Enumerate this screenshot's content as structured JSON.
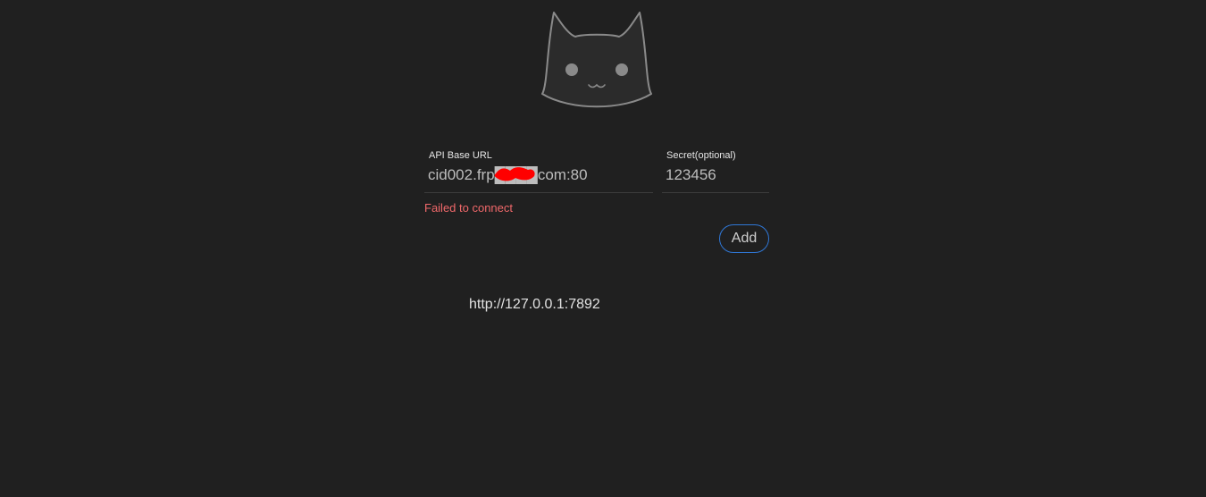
{
  "logo": {
    "icon": "cat-face-icon"
  },
  "form": {
    "api_base_url": {
      "label": "API Base URL",
      "value": "cid002.frp████com:80"
    },
    "secret": {
      "label": "Secret(optional)",
      "value": "123456"
    },
    "error": "Failed to connect",
    "add_label": "Add"
  },
  "backends": [
    {
      "url": "http://127.0.0.1:7892"
    }
  ],
  "colors": {
    "background": "#202020",
    "error": "#f0686a",
    "button_border": "#2f77d6",
    "redaction": "#ff0000"
  }
}
